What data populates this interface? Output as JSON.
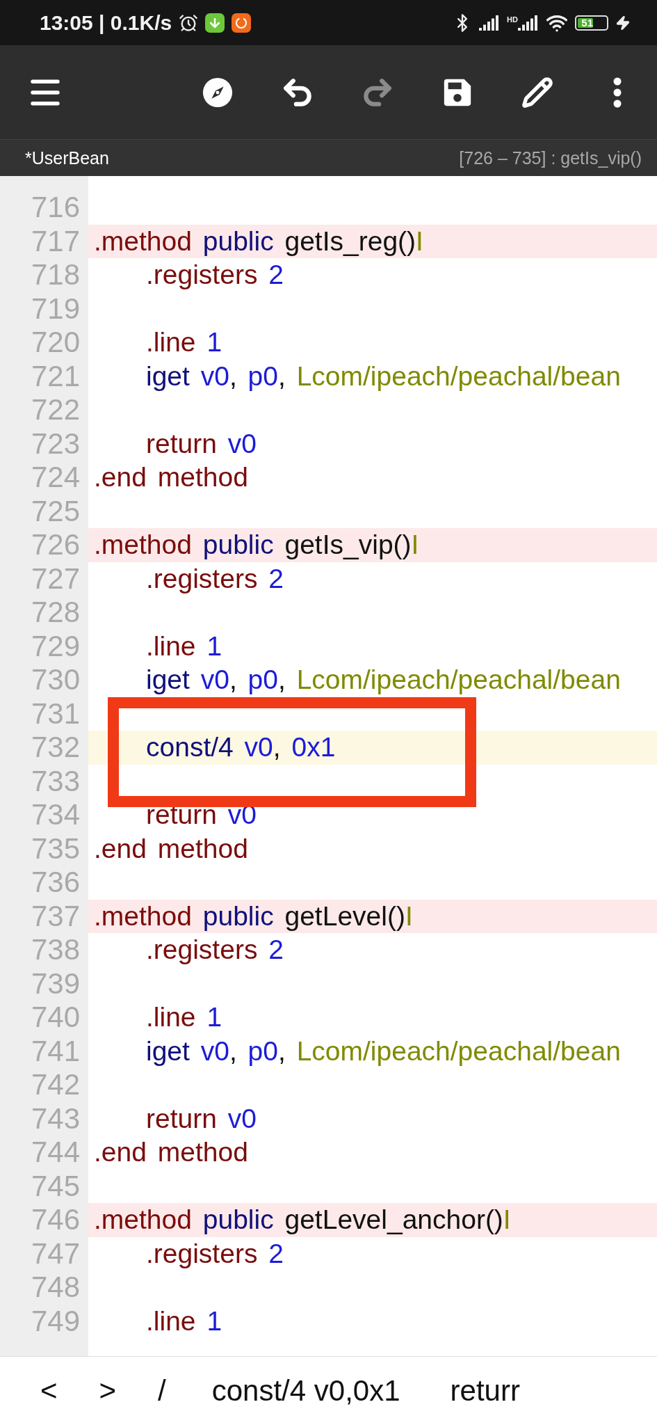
{
  "status_bar": {
    "time": "13:05 | 0.1K/s",
    "network_badge": "HD",
    "battery": "51"
  },
  "toolbar": {
    "buttons": [
      {
        "kind": "navigate",
        "disabled": false
      },
      {
        "kind": "undo",
        "disabled": false
      },
      {
        "kind": "redo",
        "disabled": true
      },
      {
        "kind": "save",
        "disabled": false
      },
      {
        "kind": "edit",
        "disabled": false
      },
      {
        "kind": "more",
        "disabled": false
      }
    ]
  },
  "file_bar": {
    "title": "*UserBean",
    "range": "[726 – 735] : getIs_vip()"
  },
  "editor": {
    "lines": [
      {
        "number": "716",
        "kind": "blank"
      },
      {
        "number": "717",
        "kind": "method",
        "indented": false,
        "tokens": [
          {
            "text": ".method",
            "kind": "directive"
          },
          {
            "text": " public",
            "kind": "keyword"
          },
          {
            "text": " getIs_reg()",
            "kind": "plain"
          },
          {
            "text": "I",
            "kind": "type"
          }
        ]
      },
      {
        "number": "718",
        "kind": "code",
        "indented": true,
        "tokens": [
          {
            "text": ".registers",
            "kind": "directive"
          },
          {
            "text": " 2",
            "kind": "value"
          }
        ]
      },
      {
        "number": "719",
        "kind": "blank"
      },
      {
        "number": "720",
        "kind": "code",
        "indented": true,
        "tokens": [
          {
            "text": ".line",
            "kind": "directive"
          },
          {
            "text": " 1",
            "kind": "value"
          }
        ]
      },
      {
        "number": "721",
        "kind": "code",
        "indented": true,
        "tokens": [
          {
            "text": "iget",
            "kind": "keyword"
          },
          {
            "text": " v0",
            "kind": "value"
          },
          {
            "text": ", ",
            "kind": "plain"
          },
          {
            "text": "p0",
            "kind": "value"
          },
          {
            "text": ", ",
            "kind": "plain"
          },
          {
            "text": "Lcom/ipeach/peachal/bean",
            "kind": "type"
          }
        ]
      },
      {
        "number": "722",
        "kind": "blank"
      },
      {
        "number": "723",
        "kind": "code",
        "indented": true,
        "tokens": [
          {
            "text": "return",
            "kind": "directive"
          },
          {
            "text": " v0",
            "kind": "value"
          }
        ]
      },
      {
        "number": "724",
        "kind": "code",
        "indented": false,
        "tokens": [
          {
            "text": ".end method",
            "kind": "directive"
          }
        ]
      },
      {
        "number": "725",
        "kind": "blank"
      },
      {
        "number": "726",
        "kind": "method",
        "indented": false,
        "tokens": [
          {
            "text": ".method",
            "kind": "directive"
          },
          {
            "text": " public",
            "kind": "keyword"
          },
          {
            "text": " getIs_vip()",
            "kind": "plain"
          },
          {
            "text": "I",
            "kind": "type"
          }
        ]
      },
      {
        "number": "727",
        "kind": "code",
        "indented": true,
        "tokens": [
          {
            "text": ".registers",
            "kind": "directive"
          },
          {
            "text": " 2",
            "kind": "value"
          }
        ]
      },
      {
        "number": "728",
        "kind": "blank"
      },
      {
        "number": "729",
        "kind": "code",
        "indented": true,
        "tokens": [
          {
            "text": ".line",
            "kind": "directive"
          },
          {
            "text": " 1",
            "kind": "value"
          }
        ]
      },
      {
        "number": "730",
        "kind": "code",
        "indented": true,
        "tokens": [
          {
            "text": "iget",
            "kind": "keyword"
          },
          {
            "text": " v0",
            "kind": "value"
          },
          {
            "text": ", ",
            "kind": "plain"
          },
          {
            "text": "p0",
            "kind": "value"
          },
          {
            "text": ", ",
            "kind": "plain"
          },
          {
            "text": "Lcom/ipeach/peachal/bean",
            "kind": "type"
          }
        ]
      },
      {
        "number": "731",
        "kind": "blank"
      },
      {
        "number": "732",
        "kind": "current",
        "indented": true,
        "tokens": [
          {
            "text": "const/4",
            "kind": "keyword"
          },
          {
            "text": " v0",
            "kind": "value"
          },
          {
            "text": ", ",
            "kind": "plain"
          },
          {
            "text": "0x1",
            "kind": "value"
          }
        ]
      },
      {
        "number": "733",
        "kind": "blank"
      },
      {
        "number": "734",
        "kind": "code",
        "indented": true,
        "tokens": [
          {
            "text": "return",
            "kind": "directive"
          },
          {
            "text": " v0",
            "kind": "value"
          }
        ]
      },
      {
        "number": "735",
        "kind": "code",
        "indented": false,
        "tokens": [
          {
            "text": ".end method",
            "kind": "directive"
          }
        ]
      },
      {
        "number": "736",
        "kind": "blank"
      },
      {
        "number": "737",
        "kind": "method",
        "indented": false,
        "tokens": [
          {
            "text": ".method",
            "kind": "directive"
          },
          {
            "text": " public",
            "kind": "keyword"
          },
          {
            "text": " getLevel()",
            "kind": "plain"
          },
          {
            "text": "I",
            "kind": "type"
          }
        ]
      },
      {
        "number": "738",
        "kind": "code",
        "indented": true,
        "tokens": [
          {
            "text": ".registers",
            "kind": "directive"
          },
          {
            "text": " 2",
            "kind": "value"
          }
        ]
      },
      {
        "number": "739",
        "kind": "blank"
      },
      {
        "number": "740",
        "kind": "code",
        "indented": true,
        "tokens": [
          {
            "text": ".line",
            "kind": "directive"
          },
          {
            "text": " 1",
            "kind": "value"
          }
        ]
      },
      {
        "number": "741",
        "kind": "code",
        "indented": true,
        "tokens": [
          {
            "text": "iget",
            "kind": "keyword"
          },
          {
            "text": " v0",
            "kind": "value"
          },
          {
            "text": ", ",
            "kind": "plain"
          },
          {
            "text": "p0",
            "kind": "value"
          },
          {
            "text": ", ",
            "kind": "plain"
          },
          {
            "text": "Lcom/ipeach/peachal/bean",
            "kind": "type"
          }
        ]
      },
      {
        "number": "742",
        "kind": "blank"
      },
      {
        "number": "743",
        "kind": "code",
        "indented": true,
        "tokens": [
          {
            "text": "return",
            "kind": "directive"
          },
          {
            "text": " v0",
            "kind": "value"
          }
        ]
      },
      {
        "number": "744",
        "kind": "code",
        "indented": false,
        "tokens": [
          {
            "text": ".end method",
            "kind": "directive"
          }
        ]
      },
      {
        "number": "745",
        "kind": "blank"
      },
      {
        "number": "746",
        "kind": "method",
        "indented": false,
        "tokens": [
          {
            "text": ".method",
            "kind": "directive"
          },
          {
            "text": " public",
            "kind": "keyword"
          },
          {
            "text": " getLevel_anchor()",
            "kind": "plain"
          },
          {
            "text": "I",
            "kind": "type"
          }
        ]
      },
      {
        "number": "747",
        "kind": "code",
        "indented": true,
        "tokens": [
          {
            "text": ".registers",
            "kind": "directive"
          },
          {
            "text": " 2",
            "kind": "value"
          }
        ]
      },
      {
        "number": "748",
        "kind": "blank"
      },
      {
        "number": "749",
        "kind": "code",
        "indented": true,
        "tokens": [
          {
            "text": ".line",
            "kind": "directive"
          },
          {
            "text": " 1",
            "kind": "value"
          }
        ]
      }
    ],
    "annotation": {
      "kind": "rectangle"
    }
  },
  "quick_bar": {
    "items": [
      "<",
      ">",
      "/",
      "const/4 v0,0x1",
      "returr"
    ]
  }
}
